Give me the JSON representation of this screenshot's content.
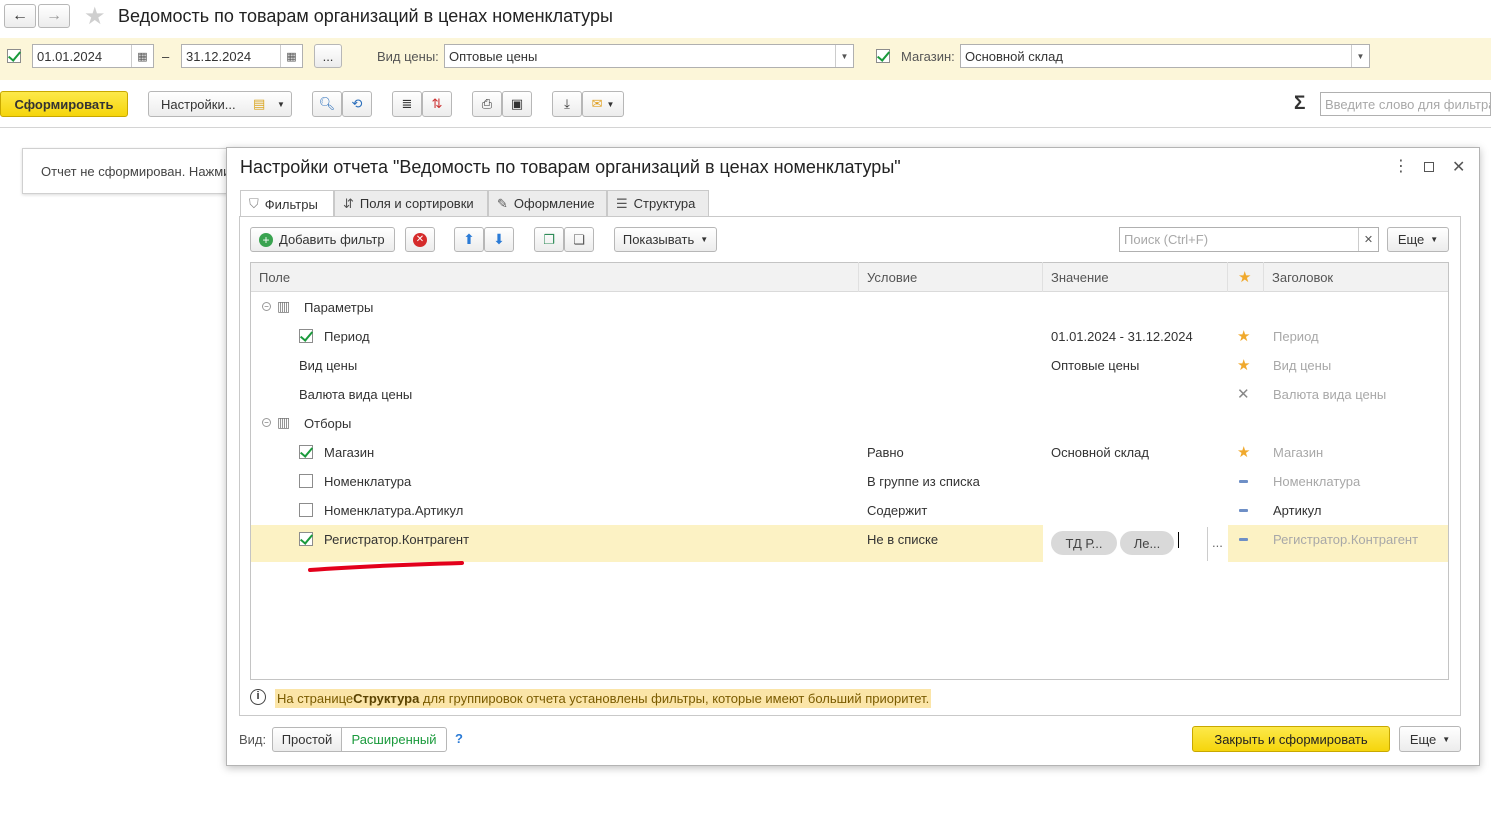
{
  "window": {
    "title": "Ведомость по товарам организаций в ценах номенклатуры"
  },
  "nav": {
    "back": "←",
    "forward": "→",
    "star": "★"
  },
  "filters_bar": {
    "date_from": "01.01.2024",
    "dash": "–",
    "date_to": "31.12.2024",
    "more": "...",
    "price_type_label": "Вид цены:",
    "price_type_value": "Оптовые цены",
    "store_label": "Магазин:",
    "store_value": "Основной склад"
  },
  "toolbar": {
    "generate": "Сформировать",
    "settings": "Настройки...",
    "sigma": "Σ",
    "search_placeholder": "Введите слово для фильтра"
  },
  "report_msg": "Отчет не сформирован. Нажми",
  "dialog": {
    "title": "Настройки отчета \"Ведомость по товарам организаций в ценах номенклатуры\"",
    "tabs": [
      "Фильтры",
      "Поля и сортировки",
      "Оформление",
      "Структура"
    ],
    "add_filter": "Добавить фильтр",
    "show": "Показывать",
    "search_placeholder": "Поиск (Ctrl+F)",
    "more": "Еще",
    "columns": {
      "field": "Поле",
      "condition": "Условие",
      "value": "Значение",
      "star": "★",
      "header": "Заголовок"
    },
    "groups": {
      "params": "Параметры",
      "filters": "Отборы"
    },
    "rows": [
      {
        "field": "Период",
        "condition": "",
        "value": "01.01.2024 - 31.12.2024",
        "header": "Период"
      },
      {
        "field": "Вид цены",
        "condition": "",
        "value": "Оптовые цены",
        "header": "Вид цены"
      },
      {
        "field": "Валюта вида цены",
        "condition": "",
        "value": "",
        "header": "Валюта вида цены"
      },
      {
        "field": "Магазин",
        "condition": "Равно",
        "value": "Основной склад",
        "header": "Магазин"
      },
      {
        "field": "Номенклатура",
        "condition": "В группе из списка",
        "value": "",
        "header": "Номенклатура"
      },
      {
        "field": "Номенклатура.Артикул",
        "condition": "Содержит",
        "value": "",
        "header": "Артикул"
      },
      {
        "field": "Регистратор.Контрагент",
        "condition": "Не в списке",
        "value": "",
        "header": "Регистратор.Контрагент"
      }
    ],
    "pills": [
      "ТД Р...",
      "Ле..."
    ],
    "ellipsis": "...",
    "info_prefix": "На странице ",
    "info_bold": "Структура",
    "info_suffix": " для группировок отчета установлены фильтры, которые имеют больший приоритет.",
    "view_label": "Вид:",
    "view_simple": "Простой",
    "view_extended": "Расширенный",
    "help": "?",
    "close_generate": "Закрыть и сформировать",
    "footer_more": "Еще"
  },
  "colors": {
    "accent_yellow": "#f5d50c",
    "filter_bar_bg": "#fcf6d9",
    "selected_row": "#fcf2c4",
    "check_green": "#1a9a3c",
    "underline_red": "#e3001b"
  }
}
